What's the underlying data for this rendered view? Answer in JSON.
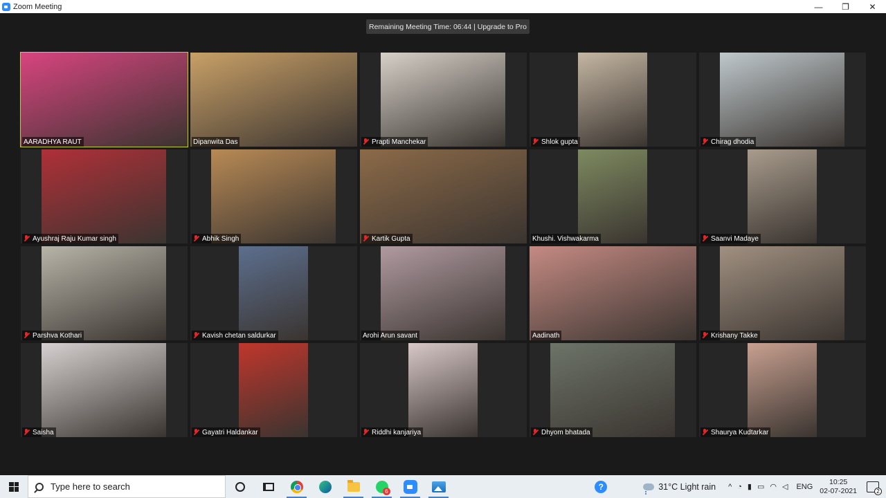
{
  "window": {
    "title": "Zoom Meeting",
    "minimize": "—",
    "maximize": "❐",
    "close": "✕"
  },
  "meeting": {
    "timer_text": "Remaining Meeting Time: 06:44 | Upgrade to Pro"
  },
  "participants": [
    {
      "name": "AARADHYA RAUT",
      "muted": false,
      "active": true
    },
    {
      "name": "Dipanwita Das",
      "muted": false
    },
    {
      "name": "Prapti Manchekar",
      "muted": true
    },
    {
      "name": "Shlok gupta",
      "muted": true
    },
    {
      "name": "Chirag dhodia",
      "muted": true
    },
    {
      "name": "Ayushraj Raju Kumar singh",
      "muted": true
    },
    {
      "name": "Abhik Singh",
      "muted": true
    },
    {
      "name": "Kartik Gupta",
      "muted": true
    },
    {
      "name": "Khushi. Vishwakarma",
      "muted": false
    },
    {
      "name": "Saanvi Madaye",
      "muted": true
    },
    {
      "name": "Parshva Kothari",
      "muted": true
    },
    {
      "name": "Kavish chetan saldurkar",
      "muted": true
    },
    {
      "name": "Arohi Arun savant",
      "muted": false
    },
    {
      "name": "Aadinath",
      "muted": false
    },
    {
      "name": "Krishany Takke",
      "muted": true
    },
    {
      "name": "Saisha",
      "muted": true
    },
    {
      "name": "Gayatri  Haldankar",
      "muted": true
    },
    {
      "name": "Riddhi kanjariya",
      "muted": true
    },
    {
      "name": "Dhyom bhatada",
      "muted": true
    },
    {
      "name": "Shaurya Kudtarkar",
      "muted": true
    }
  ],
  "taskbar": {
    "search_placeholder": "Type here to search",
    "whatsapp_badge": "6",
    "help_label": "?",
    "weather": "31°C  Light rain",
    "tray_up": "^",
    "language": "ENG",
    "time": "10:25",
    "date": "02-07-2021",
    "notifications": "2"
  }
}
